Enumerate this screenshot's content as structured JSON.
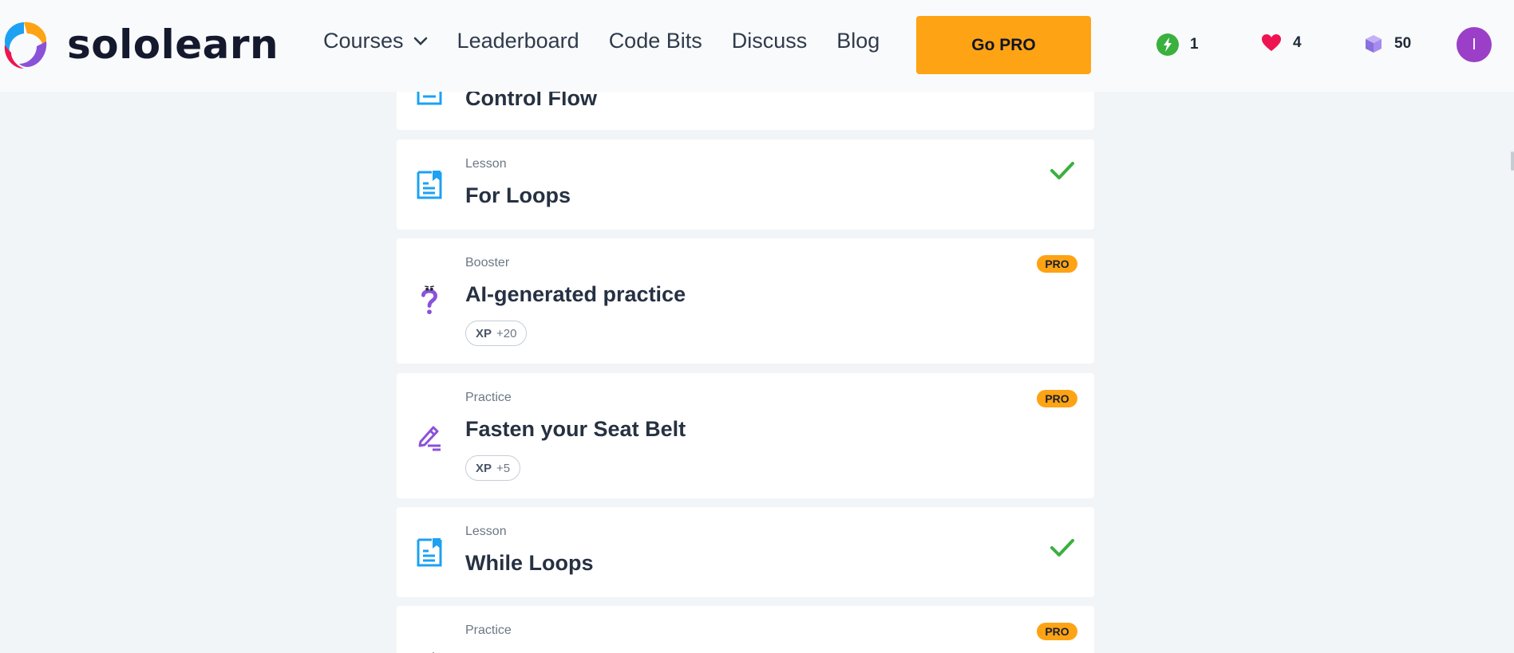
{
  "brand": {
    "name": "sololearn"
  },
  "nav": {
    "courses": "Courses",
    "leaderboard": "Leaderboard",
    "code_bits": "Code Bits",
    "discuss": "Discuss",
    "blog": "Blog"
  },
  "cta": {
    "go_pro": "Go PRO"
  },
  "stats": {
    "streak": "1",
    "hearts": "4",
    "gems": "50"
  },
  "user": {
    "avatar_initial": "I"
  },
  "colors": {
    "accent_orange": "#fea314",
    "lesson_blue": "#1da1f2",
    "practice_purple": "#8a52d8",
    "check_green": "#3ab03e",
    "heart_red": "#ee1451"
  },
  "items": [
    {
      "type": "",
      "title": "Control Flow",
      "icon": "lesson-document-icon"
    },
    {
      "type": "Lesson",
      "title": "For Loops",
      "icon": "lesson-document-icon",
      "status": "completed"
    },
    {
      "type": "Booster",
      "title": "AI-generated practice",
      "icon": "question-mark-icon",
      "pro": "PRO",
      "xp_label": "XP",
      "xp_value": "+20"
    },
    {
      "type": "Practice",
      "title": "Fasten your Seat Belt",
      "icon": "pencil-edit-icon",
      "pro": "PRO",
      "xp_label": "XP",
      "xp_value": "+5"
    },
    {
      "type": "Lesson",
      "title": "While Loops",
      "icon": "lesson-document-icon",
      "status": "completed"
    },
    {
      "type": "Practice",
      "title": "",
      "icon": "pencil-edit-icon",
      "pro": "PRO"
    }
  ]
}
